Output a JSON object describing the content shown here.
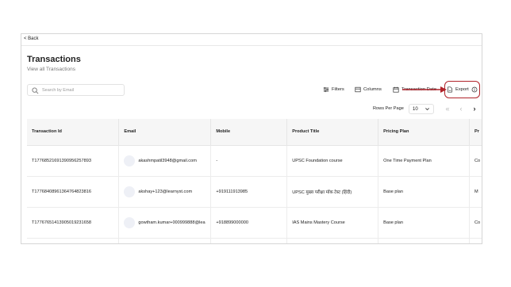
{
  "nav": {
    "back_label": "< Back"
  },
  "page": {
    "title": "Transactions",
    "subtitle": "View all Transactions"
  },
  "search": {
    "placeholder": "Search by Email"
  },
  "toolbar": {
    "filters_label": "Filters",
    "columns_label": "Columns",
    "transaction_date_label": "Transaction Date",
    "export_label": "Export"
  },
  "pagination": {
    "rows_per_page_label": "Rows Per Page",
    "rows_per_page_value": "10"
  },
  "table": {
    "headers": [
      "Transaction Id",
      "Email",
      "Mobile",
      "Product Title",
      "Pricing Plan",
      "Pr"
    ],
    "rows": [
      [
        "T17768521691390956257893",
        "akashmpatil3948@gmail.com",
        "-",
        "UPSC Foundation course",
        "One Time Payment Plan",
        "Co"
      ],
      [
        "T17768408961364764823816",
        "akshay+123@learnyst.com",
        "+919111913985",
        "UPSC मुख्य परीक्षा मॉक टेस्ट (हिंदी)",
        "Base plan",
        "M"
      ],
      [
        "T17767651413905019231658",
        "gowtham.kumar+000999888@lea",
        "+918899000000",
        "IAS Mains Mastery Course",
        "Base plan",
        "Co"
      ]
    ]
  },
  "colors": {
    "annotation": "#b0232a"
  }
}
